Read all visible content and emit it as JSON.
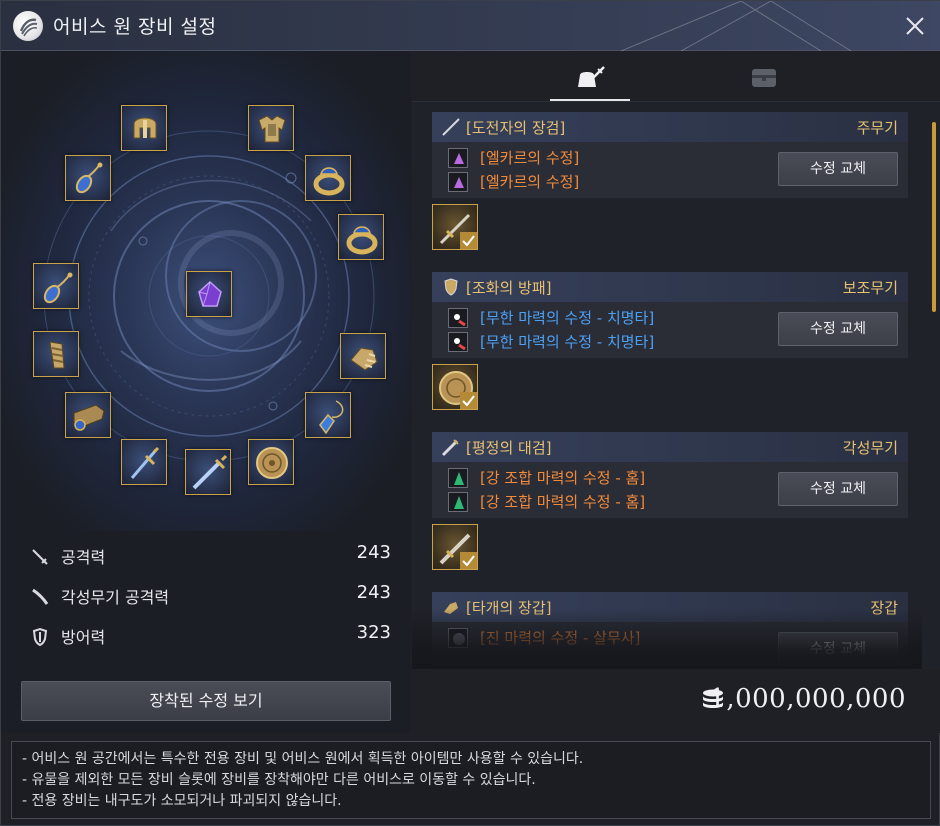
{
  "window": {
    "title": "어비스 원 장비 설정",
    "logo_icon": "abyss-one-logo-icon",
    "close_icon": "close-icon"
  },
  "left": {
    "slots": [
      {
        "name": "helmet-slot",
        "icon": "helmet-icon"
      },
      {
        "name": "armor-slot",
        "icon": "armor-icon"
      },
      {
        "name": "necklace-slot",
        "icon": "necklace-icon"
      },
      {
        "name": "ring-slot-1",
        "icon": "ring-icon"
      },
      {
        "name": "earring-slot-1",
        "icon": "earring-icon"
      },
      {
        "name": "ring-slot-2",
        "icon": "ring-icon"
      },
      {
        "name": "center-crystal-slot",
        "icon": "purple-crystal-icon"
      },
      {
        "name": "gloves-slot",
        "icon": "gloves-icon"
      },
      {
        "name": "shoes-slot",
        "icon": "shoes-icon"
      },
      {
        "name": "belt-slot",
        "icon": "belt-icon"
      },
      {
        "name": "earring-slot-2",
        "icon": "earring-icon"
      },
      {
        "name": "awakening-weapon-slot",
        "icon": "greatsword-icon"
      },
      {
        "name": "main-weapon-slot",
        "icon": "sword-icon"
      },
      {
        "name": "shield-slot",
        "icon": "shield-icon"
      }
    ],
    "stats": [
      {
        "label": "공격력",
        "value": "243",
        "icon": "sword-stat-icon"
      },
      {
        "label": "각성무기 공격력",
        "value": "243",
        "icon": "awakening-stat-icon"
      },
      {
        "label": "방어력",
        "value": "323",
        "icon": "shield-stat-icon"
      }
    ],
    "view_button": "장착된 수정 보기"
  },
  "right": {
    "tabs": [
      {
        "name": "equipment-tab",
        "icon": "equipment-bag-icon",
        "active": true
      },
      {
        "name": "storage-tab",
        "icon": "storage-chest-icon",
        "active": false
      }
    ],
    "entries": [
      {
        "name": "[도전자의 장검]",
        "type": "주무기",
        "weapon_icon": "longsword-icon",
        "crystals": [
          {
            "name": "[엘카르의 수정]",
            "color": "#f28a3a"
          },
          {
            "name": "[엘카르의 수정]",
            "color": "#f28a3a"
          }
        ],
        "swap_label": "수정 교체"
      },
      {
        "name": "[조화의 방패]",
        "type": "보조무기",
        "weapon_icon": "shield-icon",
        "crystals": [
          {
            "name": "[무한 마력의 수정 - 치명타]",
            "color": "#4ea0f5"
          },
          {
            "name": "[무한 마력의 수정 - 치명타]",
            "color": "#4ea0f5"
          }
        ],
        "swap_label": "수정 교체"
      },
      {
        "name": "[평정의 대검]",
        "type": "각성무기",
        "weapon_icon": "greatsword-icon",
        "crystals": [
          {
            "name": "[강 조합 마력의 수정 - 홈]",
            "color": "#f28a3a"
          },
          {
            "name": "[강 조합 마력의 수정 - 홈]",
            "color": "#f28a3a"
          }
        ],
        "swap_label": "수정 교체"
      },
      {
        "name": "[타개의 장갑]",
        "type": "장갑",
        "weapon_icon": "gloves-icon",
        "crystals": [
          {
            "name": "[진 마력의 수정 - 살무사]",
            "color": "#f28a3a"
          }
        ],
        "swap_label": "수정 교체"
      }
    ],
    "money": "1,000,000,000",
    "money_icon": "silver-coin-stack-icon"
  },
  "notes": [
    "- 어비스 원 공간에서는 특수한 전용 장비 및 어비스 원에서 획득한 아이템만 사용할 수 있습니다.",
    "- 유물을 제외한 모든 장비 슬롯에 장비를 장착해야만 다른 어비스로 이동할 수 있습니다.",
    "- 전용 장비는 내구도가 소모되거나 파괴되지 않습니다."
  ],
  "colors": {
    "gold": "#c9a24a",
    "label_gold": "#e8c170",
    "crystal_orange": "#f28a3a",
    "crystal_blue": "#4ea0f5"
  }
}
